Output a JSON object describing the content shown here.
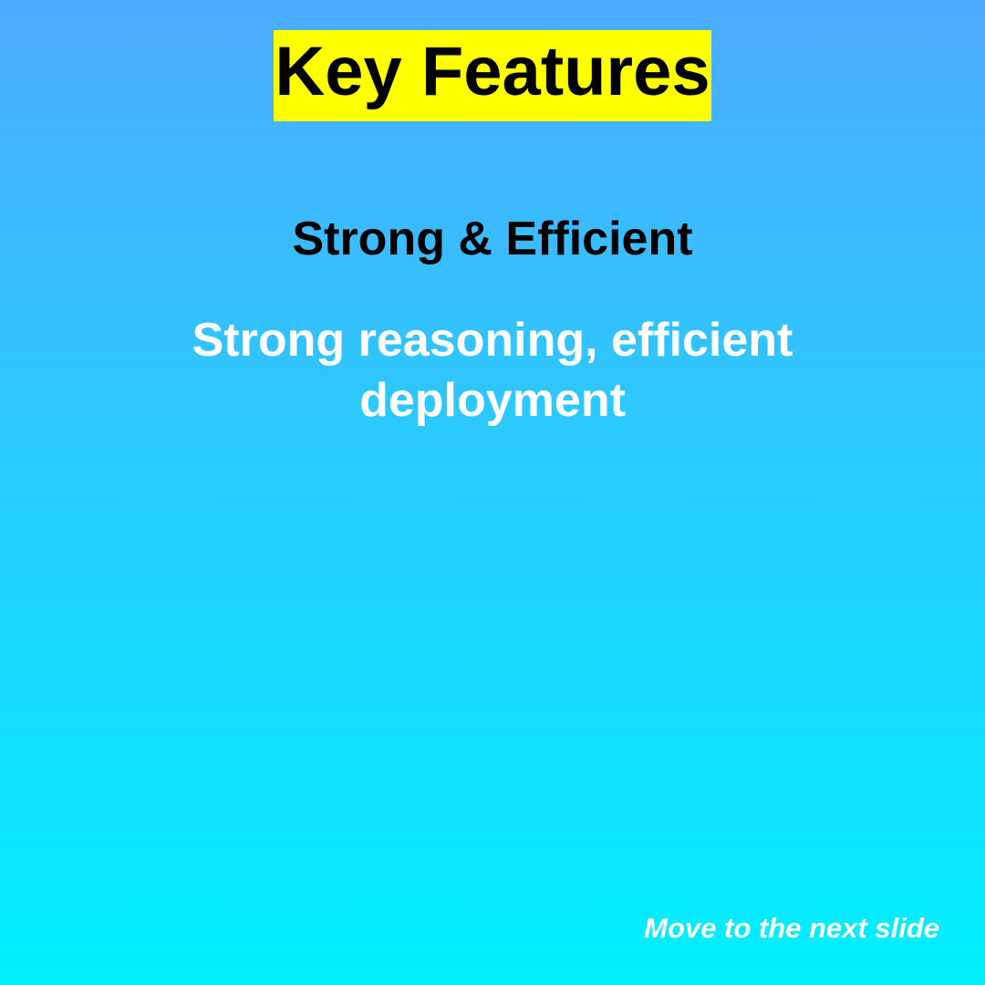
{
  "slide": {
    "title": "Key Features",
    "subtitle": "Strong & Efficient",
    "description": "Strong reasoning, efficient deployment",
    "next_label": "Move to the next slide"
  },
  "colors": {
    "background_top": "#4dabff",
    "background_bottom": "#00f0ff",
    "title_highlight": "#ffff00",
    "title_text": "#000000",
    "subtitle_text": "#000000",
    "description_text": "#ffffff",
    "next_text": "#ffffff"
  }
}
